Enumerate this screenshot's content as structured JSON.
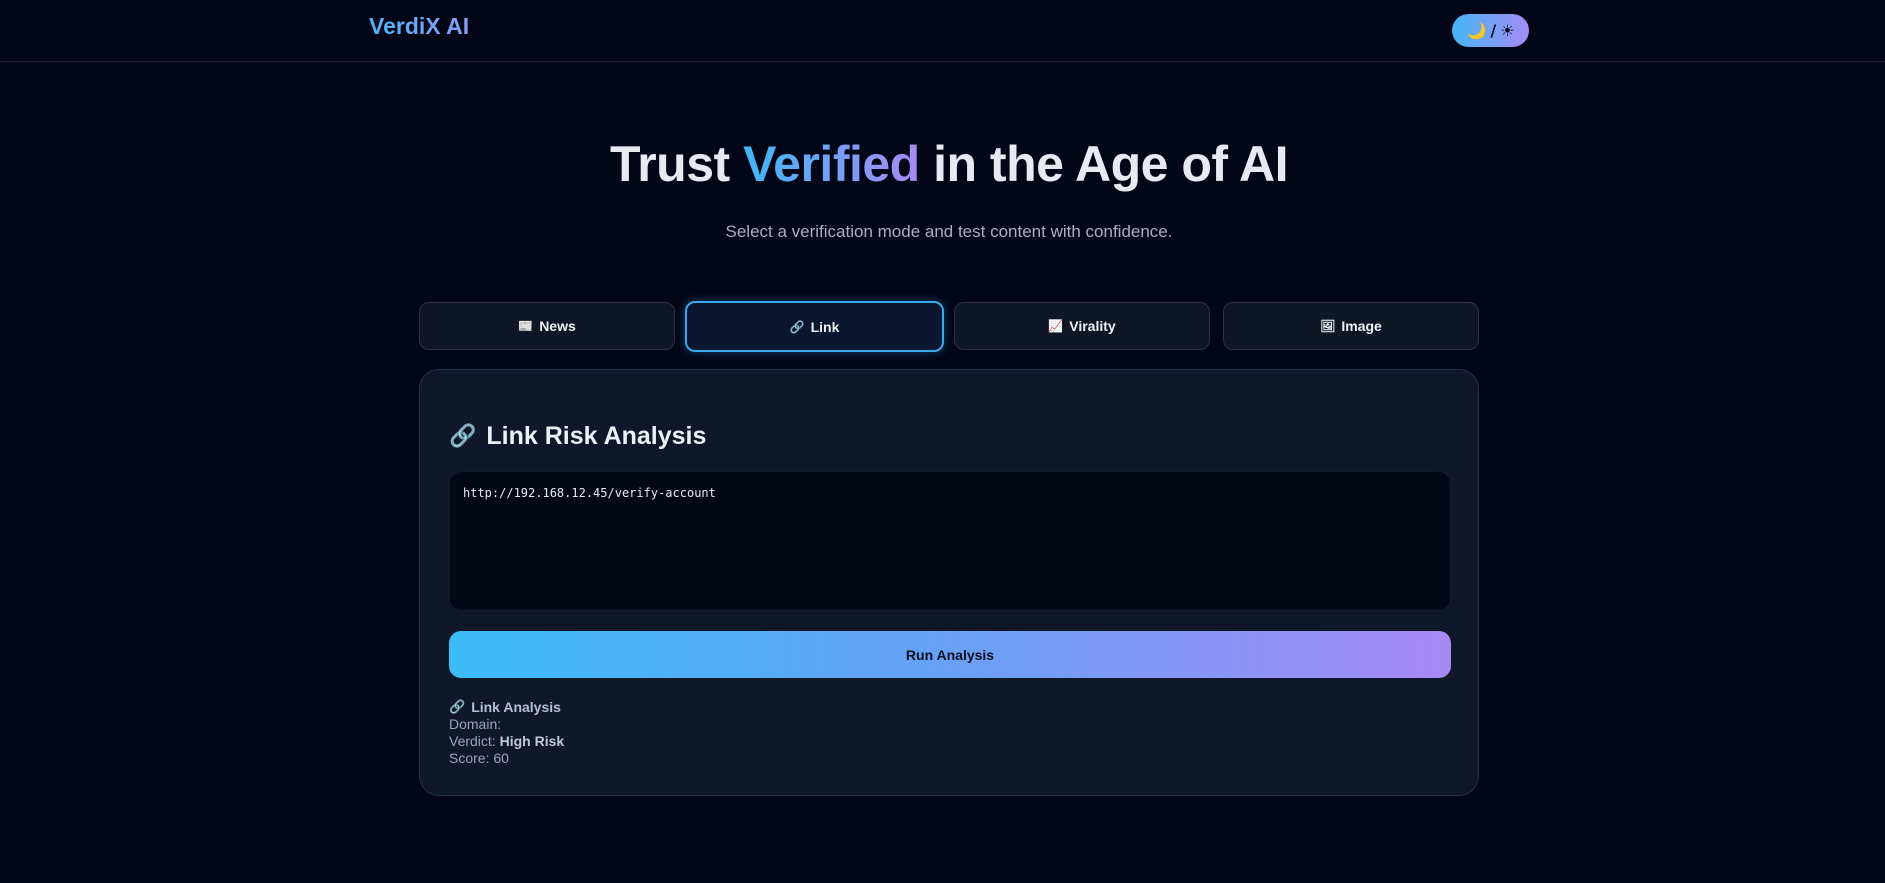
{
  "header": {
    "brand": "VerdiX AI",
    "theme_toggle": {
      "moon_icon": "🌙",
      "separator": "/",
      "sun_icon": "☀"
    }
  },
  "hero": {
    "title_prefix": "Trust ",
    "title_accent": "Verified",
    "title_suffix": " in the Age of AI",
    "subtitle": "Select a verification mode and test content with confidence."
  },
  "tabs": [
    {
      "icon": "📰",
      "label": "News",
      "active": false
    },
    {
      "icon": "🔗",
      "label": "Link",
      "active": true
    },
    {
      "icon": "📈",
      "label": "Virality",
      "active": false
    },
    {
      "icon": "🖼",
      "label": "Image",
      "active": false
    }
  ],
  "panel": {
    "title_icon": "🔗",
    "title": "Link Risk Analysis",
    "input_value": "http://192.168.12.45/verify-account",
    "run_button": "Run Analysis"
  },
  "result": {
    "icon": "🔗",
    "heading": "Link Analysis",
    "domain_label": "Domain:",
    "domain_value": "",
    "verdict_label": "Verdict:",
    "verdict_value": "High Risk",
    "score_label": "Score:",
    "score_value": "60"
  },
  "colors": {
    "background": "#030617",
    "accent_start": "#3bbcf6",
    "accent_end": "#a78af3",
    "active_tab_border": "#3aa8ec"
  }
}
